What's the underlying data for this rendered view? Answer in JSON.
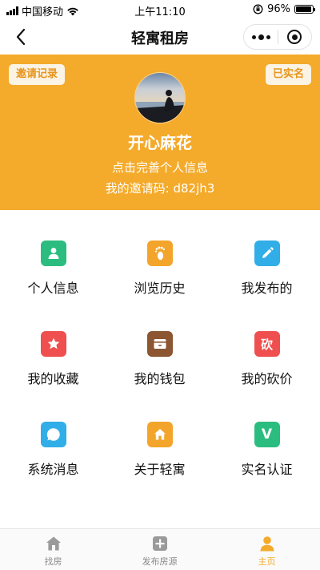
{
  "status_bar": {
    "carrier": "中国移动",
    "time": "上午11:10",
    "battery": "96%",
    "battery_level": 0.96
  },
  "nav": {
    "title": "轻寓租房"
  },
  "profile": {
    "invite_records_label": "邀请记录",
    "verified_label": "已实名",
    "nickname": "开心麻花",
    "tip": "点击完善个人信息",
    "invite_code": "我的邀请码: d82jh3"
  },
  "grid": {
    "items": [
      {
        "label": "个人信息",
        "icon": "person-icon",
        "color": "#2bbd7f"
      },
      {
        "label": "浏览历史",
        "icon": "footprint-icon",
        "color": "#f2a52a"
      },
      {
        "label": "我发布的",
        "icon": "pencil-icon",
        "color": "#31aee8"
      },
      {
        "label": "我的收藏",
        "icon": "star-icon",
        "color": "#ef4f4f"
      },
      {
        "label": "我的钱包",
        "icon": "wallet-icon",
        "color": "#8b5631"
      },
      {
        "label": "我的砍价",
        "icon": "bargain-icon",
        "color": "#ef4f4f",
        "glyph": "砍"
      },
      {
        "label": "系统消息",
        "icon": "message-bubble-icon",
        "color": "#31aee8"
      },
      {
        "label": "关于轻寓",
        "icon": "house-icon",
        "color": "#f2a52a"
      },
      {
        "label": "实名认证",
        "icon": "verify-icon",
        "color": "#2bbd7f",
        "glyph": "V"
      }
    ]
  },
  "tab_bar": {
    "tabs": [
      {
        "label": "找房",
        "icon": "house-tab-icon",
        "active": false
      },
      {
        "label": "发布房源",
        "icon": "plus-square-icon",
        "active": false
      },
      {
        "label": "主页",
        "icon": "user-tab-icon",
        "active": true
      }
    ]
  },
  "colors": {
    "accent": "#f4aa2a",
    "tab_inactive": "#8a8a8a"
  }
}
